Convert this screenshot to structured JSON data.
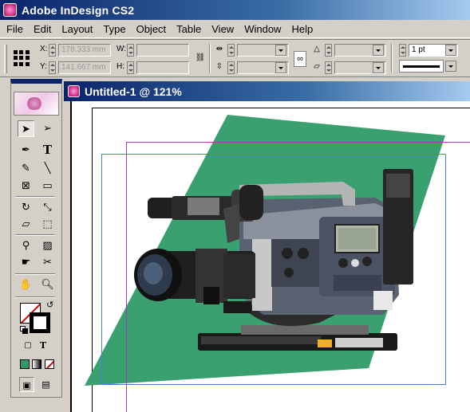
{
  "app": {
    "title": "Adobe InDesign CS2",
    "brand_color": "#0a246a"
  },
  "menu": [
    "File",
    "Edit",
    "Layout",
    "Type",
    "Object",
    "Table",
    "View",
    "Window",
    "Help"
  ],
  "control_panel": {
    "x_label": "X:",
    "x_value": "178.333 mm",
    "y_label": "Y:",
    "y_value": "141.667 mm",
    "w_label": "W:",
    "h_label": "H:",
    "stroke_weight": "1 pt"
  },
  "tools": {
    "icons": [
      "selection-tool-icon",
      "direct-selection-tool-icon",
      "pen-tool-icon",
      "type-tool-icon",
      "pencil-tool-icon",
      "line-tool-icon",
      "rectangle-frame-tool-icon",
      "rectangle-tool-icon",
      "rotate-tool-icon",
      "scale-tool-icon",
      "shear-tool-icon",
      "free-transform-tool-icon",
      "eyedropper-tool-icon",
      "gradient-tool-icon",
      "button-tool-icon",
      "scissors-tool-icon",
      "hand-tool-icon",
      "zoom-tool-icon"
    ],
    "fill_stroke": {
      "fill": "none",
      "stroke": "#000000"
    },
    "apply_color": "#2e9a6a"
  },
  "document": {
    "title": "Untitled-1 @ 121%",
    "shape_color": "#3aa070",
    "margin_guide_color": "#9b3fb3",
    "bleed_guide_color": "#4a7fd0"
  }
}
